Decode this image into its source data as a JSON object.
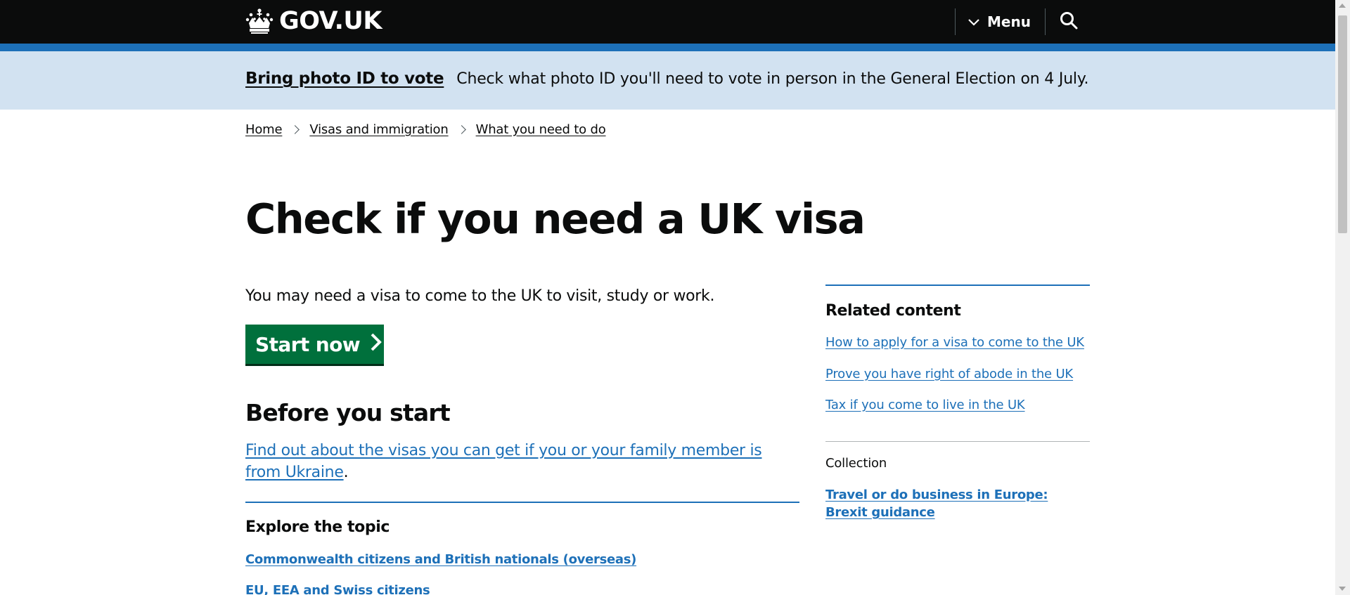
{
  "header": {
    "logo_text": "GOV.UK",
    "logo_icon": "crown-icon",
    "menu_label": "Menu",
    "menu_icon": "chevron-down-icon",
    "search_icon": "search-icon",
    "colors": {
      "header_bg": "#0b0c0c",
      "accent": "#1d70b8"
    }
  },
  "banner": {
    "link": "Bring photo ID to vote",
    "text": "Check what photo ID you'll need to vote in person in the General Election on 4 July.",
    "background": "#d2e2f1"
  },
  "breadcrumbs": [
    {
      "label": "Home"
    },
    {
      "label": "Visas and immigration"
    },
    {
      "label": "What you need to do"
    }
  ],
  "main": {
    "title": "Check if you need a UK visa",
    "lead": "You may need a visa to come to the UK to visit, study or work.",
    "start_button": "Start now",
    "start_button_color": "#00703c",
    "before_heading": "Before you start",
    "ukraine_link": "Find out about the visas you can get if you or your family member is from Ukraine",
    "ukraine_suffix": ".",
    "explore_heading": "Explore the topic",
    "topics": [
      "Commonwealth citizens and British nationals (overseas)",
      "EU, EEA and Swiss citizens"
    ]
  },
  "sidebar": {
    "title": "Related content",
    "links": [
      "How to apply for a visa to come to the UK",
      "Prove you have right of abode in the UK",
      "Tax if you come to live in the UK"
    ],
    "collection_label": "Collection",
    "collection_link": "Travel or do business in Europe: Brexit guidance"
  }
}
